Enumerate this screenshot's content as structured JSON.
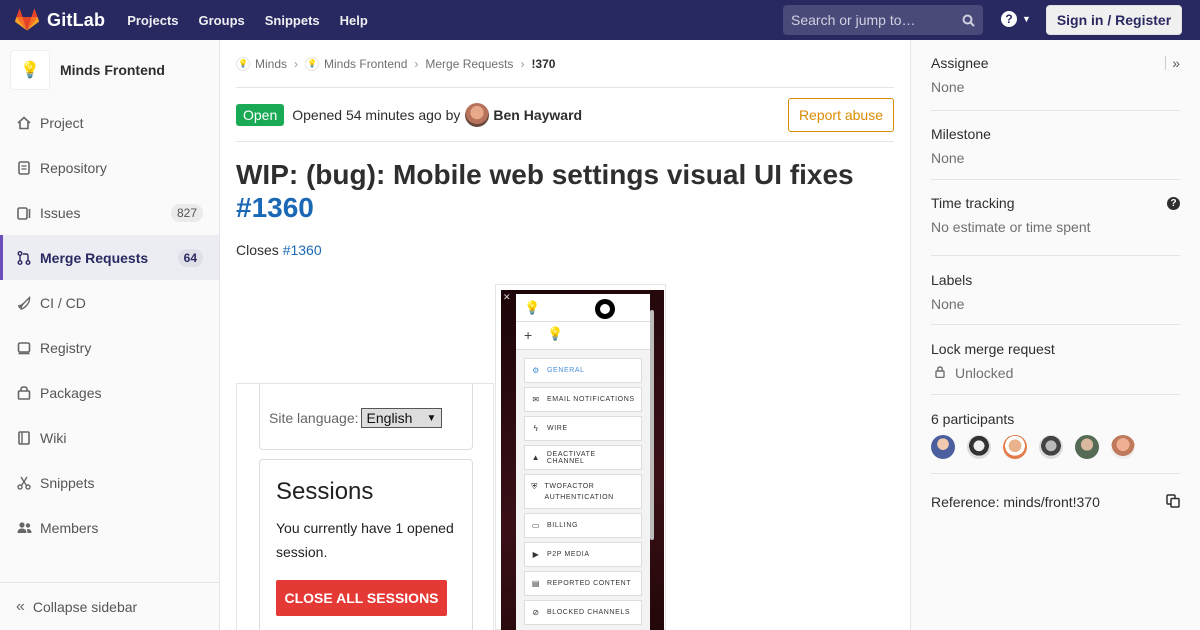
{
  "topbar": {
    "brand": "GitLab",
    "nav": [
      "Projects",
      "Groups",
      "Snippets",
      "Help"
    ],
    "search_placeholder": "Search or jump to…",
    "signin": "Sign in / Register",
    "help_icon": "?"
  },
  "sidebar": {
    "project_name": "Minds Frontend",
    "items": [
      {
        "label": "Project",
        "icon": "home-icon"
      },
      {
        "label": "Repository",
        "icon": "doc-icon"
      },
      {
        "label": "Issues",
        "icon": "issues-icon",
        "badge": "827"
      },
      {
        "label": "Merge Requests",
        "icon": "merge-icon",
        "badge": "64",
        "active": true
      },
      {
        "label": "CI / CD",
        "icon": "rocket-icon"
      },
      {
        "label": "Registry",
        "icon": "disk-icon"
      },
      {
        "label": "Packages",
        "icon": "package-icon"
      },
      {
        "label": "Wiki",
        "icon": "book-icon"
      },
      {
        "label": "Snippets",
        "icon": "scissors-icon"
      },
      {
        "label": "Members",
        "icon": "users-icon"
      }
    ],
    "collapse": "Collapse sidebar"
  },
  "breadcrumb": {
    "items": [
      "Minds",
      "Minds Frontend",
      "Merge Requests"
    ],
    "current": "!370"
  },
  "mr": {
    "status": "Open",
    "opened": "Opened 54 minutes ago by",
    "author": "Ben Hayward",
    "report": "Report abuse",
    "title": "WIP: (bug): Mobile web settings visual UI fixes",
    "title_ref": "#1360",
    "closes_label": "Closes",
    "closes_ref": "#1360"
  },
  "shot1": {
    "lang_label": "Site language:",
    "lang_value": "English",
    "sessions_title": "Sessions",
    "sessions_text": "You currently have 1 opened session.",
    "sessions_button": "CLOSE ALL SESSIONS"
  },
  "shot2": {
    "plus": "+",
    "menu": [
      "GENERAL",
      "EMAIL NOTIFICATIONS",
      "WIRE",
      "DEACTIVATE CHANNEL",
      "TWOFACTOR AUTHENTICATION",
      "BILLING",
      "P2P MEDIA",
      "REPORTED CONTENT",
      "BLOCKED CHANNELS"
    ]
  },
  "right": {
    "assignee_title": "Assignee",
    "assignee_val": "None",
    "milestone_title": "Milestone",
    "milestone_val": "None",
    "time_title": "Time tracking",
    "time_val": "No estimate or time spent",
    "labels_title": "Labels",
    "labels_val": "None",
    "lock_title": "Lock merge request",
    "lock_val": "Unlocked",
    "participants_title": "6 participants",
    "reference": "Reference: minds/front!370"
  }
}
